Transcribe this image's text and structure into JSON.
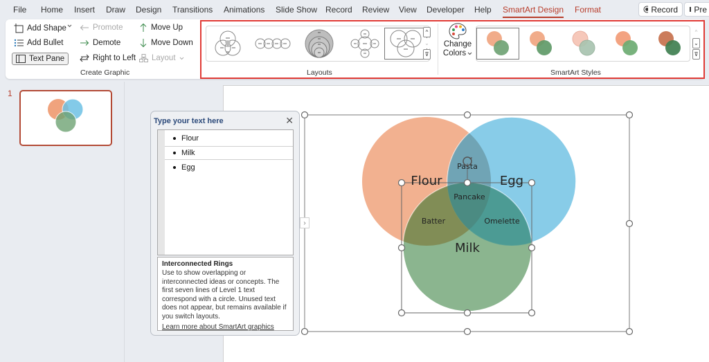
{
  "menu": {
    "tabs": [
      "File",
      "Home",
      "Insert",
      "Draw",
      "Design",
      "Transitions",
      "Animations",
      "Slide Show",
      "Record",
      "Review",
      "View",
      "Developer",
      "Help",
      "SmartArt Design",
      "Format"
    ],
    "active_tab": "SmartArt Design",
    "record_button": "Record",
    "present_button": "Pre"
  },
  "ribbon": {
    "create_graphic": {
      "add_shape": "Add Shape",
      "add_bullet": "Add Bullet",
      "text_pane": "Text Pane",
      "promote": "Promote",
      "demote": "Demote",
      "right_to_left": "Right to Left",
      "move_up": "Move Up",
      "move_down": "Move Down",
      "layout": "Layout",
      "group_label": "Create Graphic"
    },
    "layouts": {
      "group_label": "Layouts",
      "items": [
        "Basic Venn",
        "Linear Venn",
        "Stacked Venn",
        "Radial Venn",
        "Interconnected Rings"
      ],
      "selected": "Interconnected Rings"
    },
    "change_colors": {
      "line1": "Change",
      "line2": "Colors"
    },
    "smartart_styles": {
      "group_label": "SmartArt Styles",
      "items": [
        "Simple Fill",
        "Subtle Effect",
        "Moderate Effect",
        "Intense Effect",
        "Polished"
      ],
      "selected": "Simple Fill"
    }
  },
  "slides_pane": {
    "slide_number": "1"
  },
  "text_pane": {
    "title": "Type your text here",
    "items": [
      "Flour",
      "Milk",
      "Egg"
    ],
    "selected_item": "Milk",
    "description_title": "Interconnected Rings",
    "description_body": "Use to show overlapping or interconnected ideas or concepts. The first seven lines of Level 1 text correspond with a circle. Unused text does not appear, but remains available if you switch layouts.",
    "learn_more_link": "Learn more about SmartArt graphics"
  },
  "diagram": {
    "circles": [
      {
        "label": "Flour",
        "color": "#f0a37d"
      },
      {
        "label": "Egg",
        "color": "#6ec1e4"
      },
      {
        "label": "Milk",
        "color": "#6fa374"
      }
    ],
    "overlaps": {
      "flour_egg": "Pasta",
      "flour_milk": "Batter",
      "egg_milk": "Omelette",
      "all": "Pancake"
    }
  },
  "colors": {
    "accent": "#b83c2a",
    "highlight_box": "#e03a35"
  }
}
